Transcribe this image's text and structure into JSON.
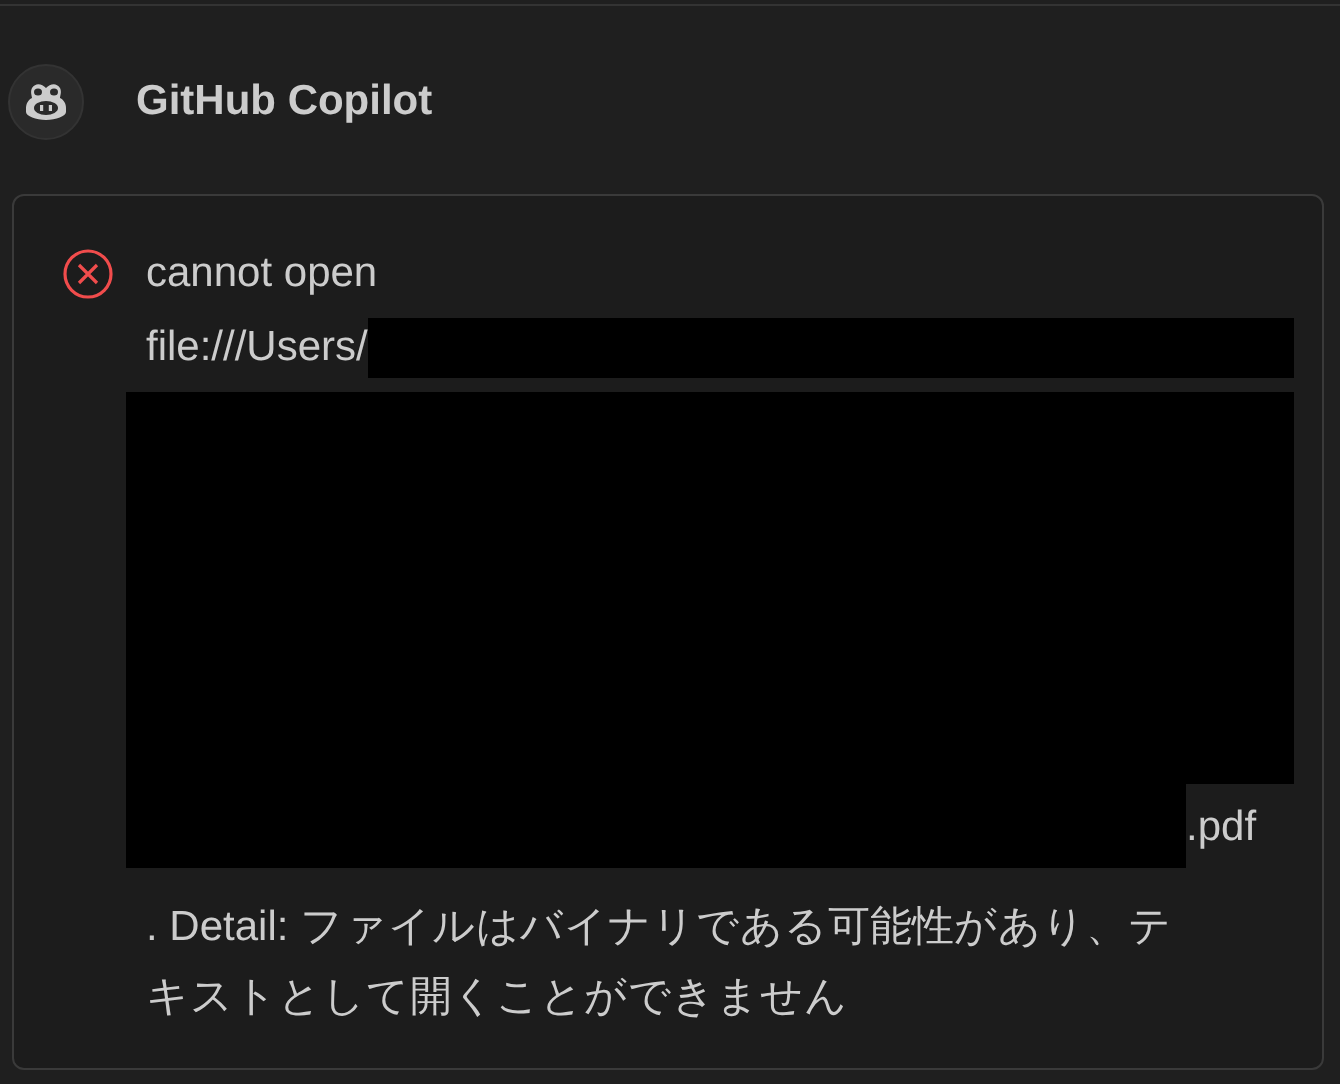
{
  "chat": {
    "author": "GitHub Copilot",
    "error": {
      "line_1": "cannot open",
      "path_start": "file:///Users/",
      "path_end": ".pdf",
      "detail": ". Detail: ファイルはバイナリである可能性があり、テキストとして開くことができません"
    }
  }
}
